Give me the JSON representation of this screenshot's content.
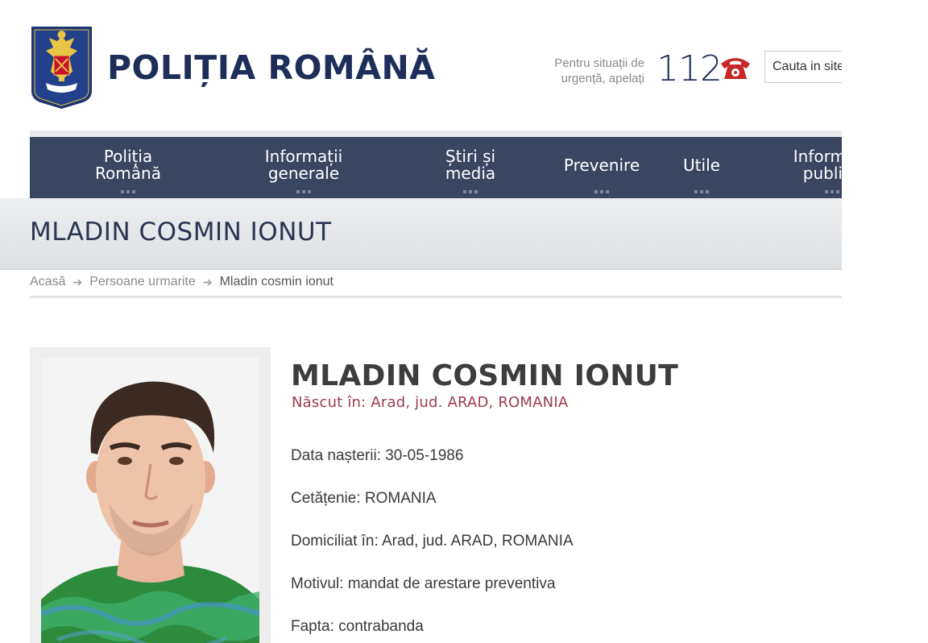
{
  "header": {
    "site_title": "POLIȚIA ROMÂNĂ",
    "emergency_text": "Pentru situații de urgență, apelați",
    "emergency_number": "112",
    "search_placeholder": "Cauta in site"
  },
  "nav": {
    "items": [
      {
        "label": "Poliția\nRomână"
      },
      {
        "label": "Informații\ngenerale"
      },
      {
        "label": "Știri și\nmedia"
      },
      {
        "label": "Prevenire"
      },
      {
        "label": "Utile"
      },
      {
        "label": "Informații\npublice"
      }
    ]
  },
  "page_title": "MLADIN COSMIN IONUT",
  "breadcrumb": {
    "home": "Acasă",
    "section": "Persoane urmarite",
    "current": "Mladin cosmin ionut"
  },
  "profile": {
    "name": "MLADIN COSMIN IONUT",
    "birthplace": "Născut în: Arad, jud. ARAD, ROMANIA",
    "birth_date": "Data nașterii: 30-05-1986",
    "citizenship": "Cetățenie: ROMANIA",
    "residence": "Domiciliat în: Arad, jud. ARAD, ROMANIA",
    "reason": "Motivul: mandat de arestare preventiva",
    "offense": "Fapta: contrabanda"
  },
  "colors": {
    "brand_navy": "#1e2e5a",
    "nav_background": "#3a4660",
    "birthplace_accent": "#9c3a4f",
    "phone_icon": "#c62828"
  },
  "icons": [
    "police-crest-logo",
    "phone-icon",
    "breadcrumb-arrow-icon"
  ]
}
